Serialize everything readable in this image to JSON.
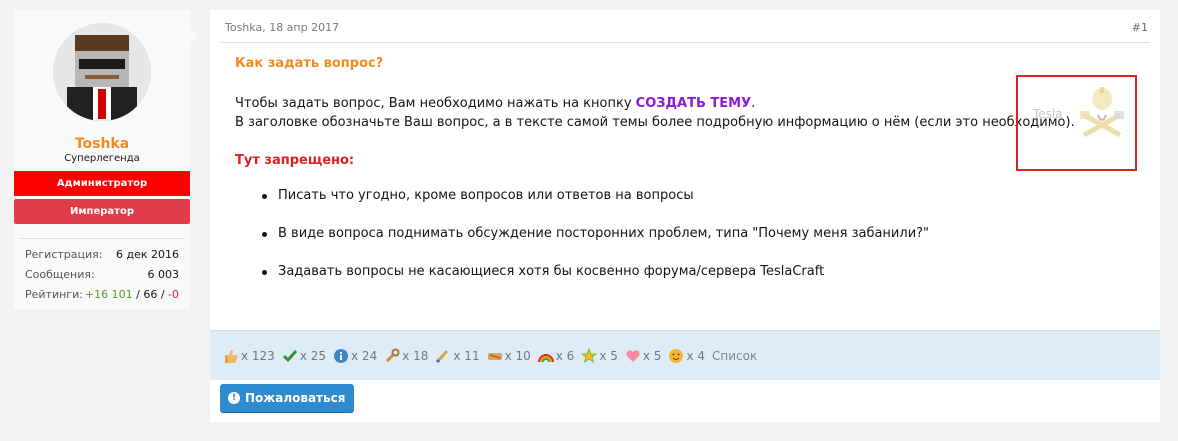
{
  "user": {
    "name": "Toshka",
    "title": "Суперлегенда",
    "banners": [
      "Администратор",
      "Император"
    ],
    "stats": {
      "reg_label": "Регистрация:",
      "reg_value": "6 дек 2016",
      "msg_label": "Сообщения:",
      "msg_value": "6 003",
      "rating_label": "Рейтинги:",
      "rating_pos": "+16 101",
      "rating_sep1": " / ",
      "rating_neutral": "66",
      "rating_sep2": " / ",
      "rating_neg": "-0"
    }
  },
  "post": {
    "header": "Toshka, 18 апр 2017",
    "number": "#1",
    "question_title": "Как задать вопрос?",
    "p1_before": "Чтобы задать вопрос, Вам необходимо нажать на кнопку ",
    "p1_link": "СОЗДАТЬ ТЕМУ",
    "p1_after": ".",
    "p2": "В заголовке обозначьте Ваш вопрос, а в тексте самой темы более подробную информацию о нём (если это необходимо).",
    "forbidden_title": "Тут запрещено:",
    "rules": [
      "Писать что угодно, кроме вопросов или ответов на вопросы",
      "В виде вопроса поднимать обсуждение посторонних проблем, типа \"Почему меня забанили?\"",
      "Задавать вопросы не касающиеся хотя бы косвенно форума/сервера TeslaCraft"
    ],
    "signature_text": "Tesla"
  },
  "reactions": [
    {
      "icon": "thumbs-up-icon",
      "count": "x 123"
    },
    {
      "icon": "checkmark-icon",
      "count": "x 25"
    },
    {
      "icon": "info-icon",
      "count": "x 24"
    },
    {
      "icon": "wrench-icon",
      "count": "x 18"
    },
    {
      "icon": "brush-icon",
      "count": "x 11"
    },
    {
      "icon": "handshake-icon",
      "count": "x 10"
    },
    {
      "icon": "rainbow-icon",
      "count": "x 6"
    },
    {
      "icon": "star-icon",
      "count": "x 5"
    },
    {
      "icon": "heart-icon",
      "count": "x 5"
    },
    {
      "icon": "smiley-icon",
      "count": "x 4"
    }
  ],
  "reactions_list_label": "Список",
  "report_button": "Пожаловаться",
  "colors": {
    "username": "#f58a1f",
    "admin_banner": "#ff0000",
    "emperor_banner": "#e33c4a",
    "link": "#8c1bd8",
    "button": "#2e8bd0"
  }
}
